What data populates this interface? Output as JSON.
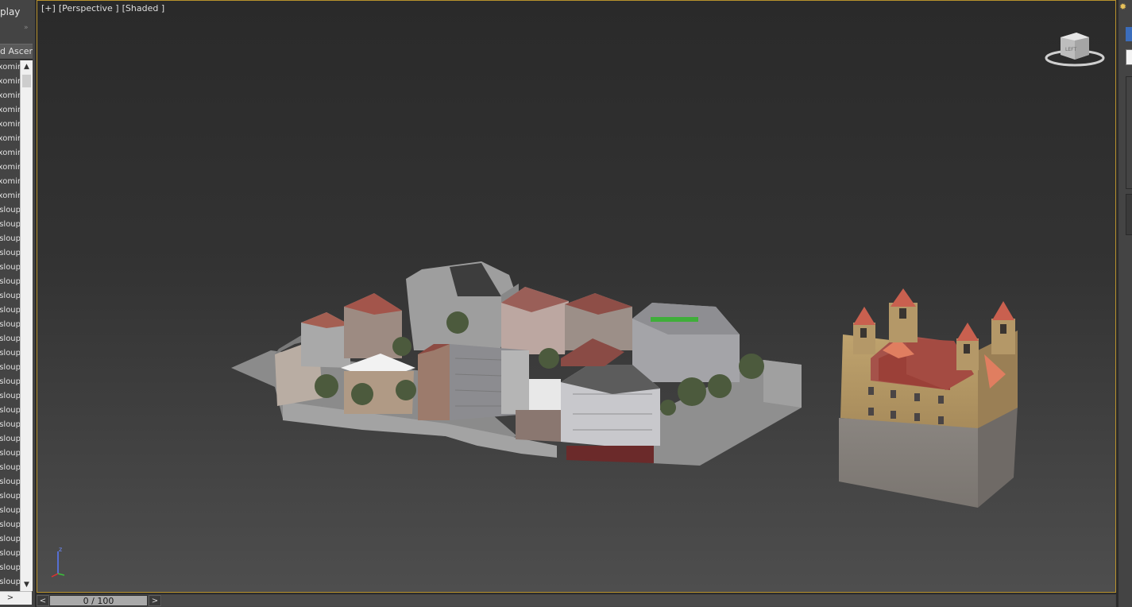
{
  "left_panel": {
    "title": "play",
    "column_header": "d Ascen",
    "items": [
      "xomir",
      "xomir",
      "xomir",
      "xomir",
      "xomir",
      "xomir",
      "xomir",
      "xomir",
      "xomir",
      "xomir",
      "sloup",
      "sloup",
      "sloup",
      "sloup",
      "sloup",
      "sloup",
      "sloup",
      "sloup",
      "sloup",
      "sloup",
      "sloup",
      "sloup",
      "sloup",
      "sloup",
      "sloup",
      "sloup",
      "sloup",
      "sloup",
      "sloup",
      "sloup",
      "sloup",
      "sloup",
      "sloup",
      "sloup",
      "sloup",
      "sloup",
      "sloup"
    ],
    "scroll_up_icon": "▲",
    "scroll_down_icon": "▼",
    "scroll_right_icon": ">"
  },
  "viewport": {
    "label_parts": [
      "[+]",
      "[Perspective ]",
      "[Shaded ]"
    ],
    "viewcube_face": "LEFT",
    "axis": {
      "z": "z",
      "y": "y",
      "x": "x"
    }
  },
  "timebar": {
    "prev": "<",
    "frame": "0 / 100",
    "next": ">"
  },
  "colors": {
    "viewport_border": "#b8922d",
    "panel_bg": "#444444"
  }
}
